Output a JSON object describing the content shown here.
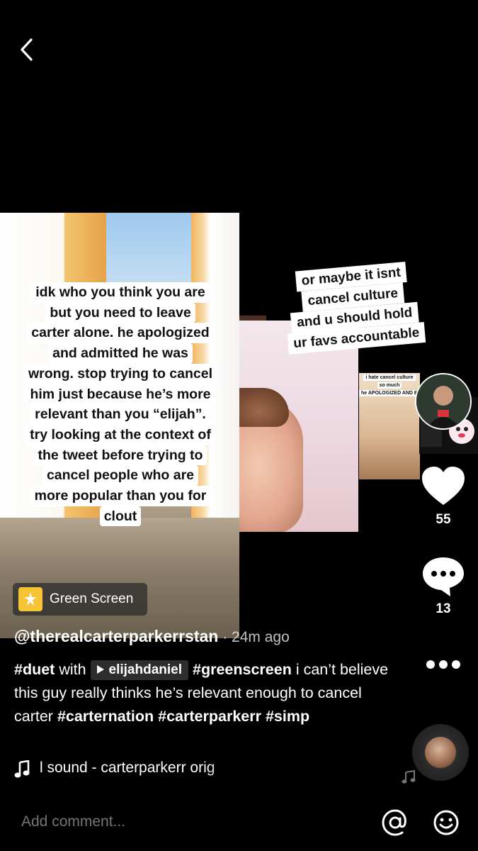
{
  "left_caption": [
    "idk who you think you are",
    "but you need to leave",
    "carter alone. he apologized",
    "and admitted he was",
    "wrong. stop trying to cancel",
    "him just because he’s more",
    "relevant than you “elijah”.",
    "try looking at the context of",
    "the tweet before trying to",
    "cancel people who are",
    "more popular than you for",
    "clout"
  ],
  "right_caption": [
    "or maybe it isnt",
    "cancel culture",
    "and u should hold",
    "ur favs accountable"
  ],
  "mini_video_labels": [
    "i hate cancel culture",
    "so much",
    "he APOLOGIZED AND EXPLAINED HIMSELF"
  ],
  "green_screen": {
    "label": "Green Screen"
  },
  "actions": {
    "likes": "55",
    "comments": "13"
  },
  "author": {
    "username": "@therealcarterparkerrstan",
    "time": " · 24m ago"
  },
  "description": {
    "duet_tag": "#duet",
    "with_text": " with ",
    "duet_user": "elijahdaniel",
    "greenscreen_tag": "#greenscreen",
    "text": " i can’t believe this guy really thinks he’s relevant enough to cancel carter ",
    "tag1": "#carternation",
    "tag2": "#carterparkerr",
    "tag3": "#simp"
  },
  "sound": {
    "text": "l sound - carterparkerr     orig"
  },
  "comment_bar": {
    "placeholder": "Add comment..."
  },
  "colors": {
    "background": "#000000",
    "like": "#ffffff",
    "green_screen_icon": "#f7c436"
  }
}
